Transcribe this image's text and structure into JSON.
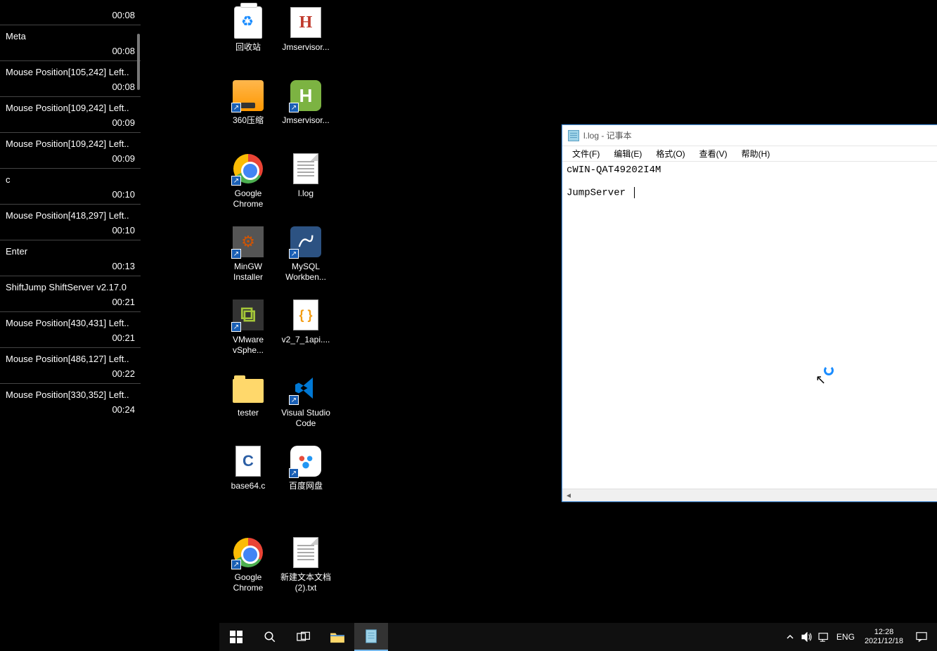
{
  "log": {
    "entries": [
      {
        "label": "",
        "time": "00:08"
      },
      {
        "label": "Meta",
        "time": "00:08"
      },
      {
        "label": "Mouse Position[105,242] Left..",
        "time": "00:08"
      },
      {
        "label": "Mouse Position[109,242] Left..",
        "time": "00:09"
      },
      {
        "label": "Mouse Position[109,242] Left..",
        "time": "00:09"
      },
      {
        "label": "c",
        "time": "00:10"
      },
      {
        "label": "Mouse Position[418,297] Left..",
        "time": "00:10"
      },
      {
        "label": "Enter",
        "time": "00:13"
      },
      {
        "label": "ShiftJump ShiftServer v2.17.0",
        "time": "00:21"
      },
      {
        "label": "Mouse Position[430,431] Left..",
        "time": "00:21"
      },
      {
        "label": "Mouse Position[486,127] Left..",
        "time": "00:22"
      },
      {
        "label": "Mouse Position[330,352] Left..",
        "time": "00:24"
      }
    ]
  },
  "desktop_icons": [
    [
      {
        "name": "recycle-bin",
        "label": "回收站",
        "type": "recycle",
        "shortcut": false
      },
      {
        "name": "jmservisor1",
        "label": "Jmservisor...",
        "type": "H",
        "shortcut": false
      }
    ],
    [
      {
        "name": "360zip",
        "label": "360压缩",
        "type": "360",
        "shortcut": true
      },
      {
        "name": "jmservisor2",
        "label": "Jmservisor...",
        "type": "Hgreen",
        "shortcut": true
      }
    ],
    [
      {
        "name": "chrome",
        "label": "Google Chrome",
        "type": "chrome",
        "shortcut": true
      },
      {
        "name": "llog",
        "label": "l.log",
        "type": "txt",
        "shortcut": false
      }
    ],
    [
      {
        "name": "mingw",
        "label": "MinGW Installer",
        "type": "mingw",
        "shortcut": true
      },
      {
        "name": "mysql-wb",
        "label": "MySQL Workben...",
        "type": "mysql",
        "shortcut": true
      }
    ],
    [
      {
        "name": "vmware",
        "label": "VMware vSphe...",
        "type": "vmware",
        "shortcut": true
      },
      {
        "name": "v27api",
        "label": "v2_7_1api....",
        "type": "json",
        "shortcut": false
      }
    ],
    [
      {
        "name": "tester-folder",
        "label": "tester",
        "type": "folder",
        "shortcut": false
      },
      {
        "name": "vscode",
        "label": "Visual Studio Code",
        "type": "vscode",
        "shortcut": true
      }
    ],
    [
      {
        "name": "base64c",
        "label": "base64.c",
        "type": "c",
        "shortcut": false
      },
      {
        "name": "baidu",
        "label": "百度网盘",
        "type": "baidu",
        "shortcut": true
      }
    ],
    [
      {
        "name": "chrome2",
        "label": "Google Chrome",
        "type": "chrome",
        "shortcut": true
      },
      {
        "name": "newtxt",
        "label": "新建文本文档 (2).txt",
        "type": "txt",
        "shortcut": false
      }
    ]
  ],
  "notepad": {
    "title": "l.log - 记事本",
    "menus": [
      "文件(F)",
      "编辑(E)",
      "格式(O)",
      "查看(V)",
      "帮助(H)"
    ],
    "content_line1": "cWIN-QAT49202I4M",
    "content_line2": "JumpServer "
  },
  "taskbar": {
    "lang": "ENG",
    "time": "12:28",
    "date": "2021/12/18"
  }
}
